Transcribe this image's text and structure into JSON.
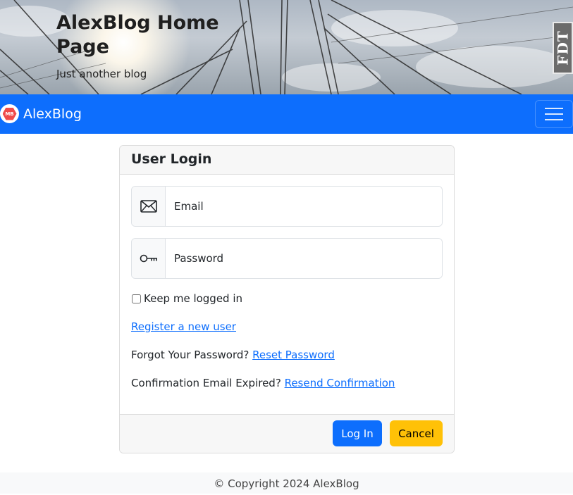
{
  "header": {
    "title": "AlexBlog Home Page",
    "tagline": "Just another blog",
    "badge_text": "FDT"
  },
  "navbar": {
    "brand_logo_text": "MB",
    "brand_name": "AlexBlog",
    "accent_color": "#0d6efd",
    "toggler_icon": "hamburger-menu-icon"
  },
  "login_card": {
    "title": "User Login",
    "email": {
      "placeholder": "Email",
      "value": "",
      "icon": "envelope-icon"
    },
    "password": {
      "placeholder": "Password",
      "value": "",
      "icon": "key-icon"
    },
    "remember_label": "Keep me logged in",
    "remember_checked": false,
    "register_link": "Register a new user",
    "forgot_text": "Forgot Your Password?",
    "reset_link": "Reset Password",
    "expired_text": "Confirmation Email Expired?",
    "resend_link": "Resend Confirmation",
    "login_button": "Log In",
    "cancel_button": "Cancel"
  },
  "footer": {
    "copyright": "© Copyright 2024 AlexBlog"
  }
}
